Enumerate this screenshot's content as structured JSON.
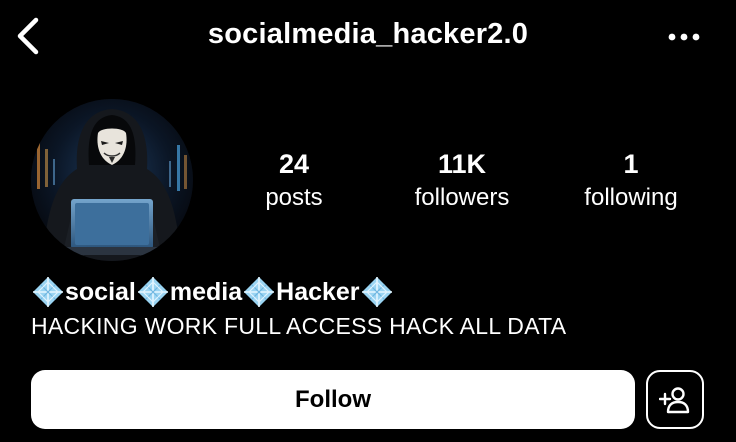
{
  "header": {
    "username": "socialmedia_hacker2.0",
    "back_icon": "chevron-left-icon",
    "more_icon": "more-dots-icon"
  },
  "profile": {
    "avatar_description_icon": "hooded-hacker-avatar",
    "stats": [
      {
        "value": "24",
        "label": "posts"
      },
      {
        "value": "11K",
        "label": "followers"
      },
      {
        "value": "1",
        "label": "following"
      }
    ],
    "display_name_parts": [
      "social",
      "media",
      "Hacker"
    ],
    "name_decoration_icon": "sparkle-diamond-icon",
    "bio": "HACKING WORK FULL ACCESS HACK ALL DATA"
  },
  "actions": {
    "follow_label": "Follow",
    "suggest_icon": "add-person-icon"
  },
  "colors": {
    "background": "#000000",
    "text": "#ffffff",
    "follow_button": "#ffffff",
    "follow_text": "#000000",
    "gem": "#9ad4f2"
  }
}
